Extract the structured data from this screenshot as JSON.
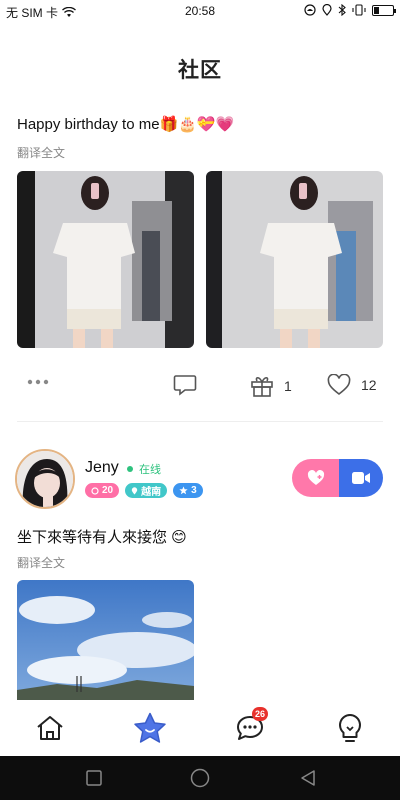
{
  "status_bar": {
    "carrier": "无 SIM 卡",
    "time": "20:58",
    "battery_level": 0.25
  },
  "page": {
    "title": "社区"
  },
  "post1": {
    "text": "Happy birthday to me🎁🎂💝💗",
    "translate_label": "翻译全文",
    "gift_count": "1",
    "like_count": "12"
  },
  "post2": {
    "user": {
      "name": "Jeny",
      "status": "在线",
      "level": "20",
      "location": "越南",
      "stars": "3"
    },
    "text": "坐下來等待有人來接您 😊",
    "translate_label": "翻译全文"
  },
  "bottom_nav": {
    "items": [
      {
        "name": "home",
        "icon": "home-icon"
      },
      {
        "name": "community",
        "icon": "star-icon",
        "active": true
      },
      {
        "name": "messages",
        "icon": "chat-icon",
        "badge": "26"
      },
      {
        "name": "discover",
        "icon": "lightbulb-icon"
      }
    ]
  },
  "colors": {
    "accent_blue": "#3c6fe8",
    "accent_pink": "#ff78aa",
    "online_green": "#2ec27e",
    "badge_red": "#e8312c"
  }
}
